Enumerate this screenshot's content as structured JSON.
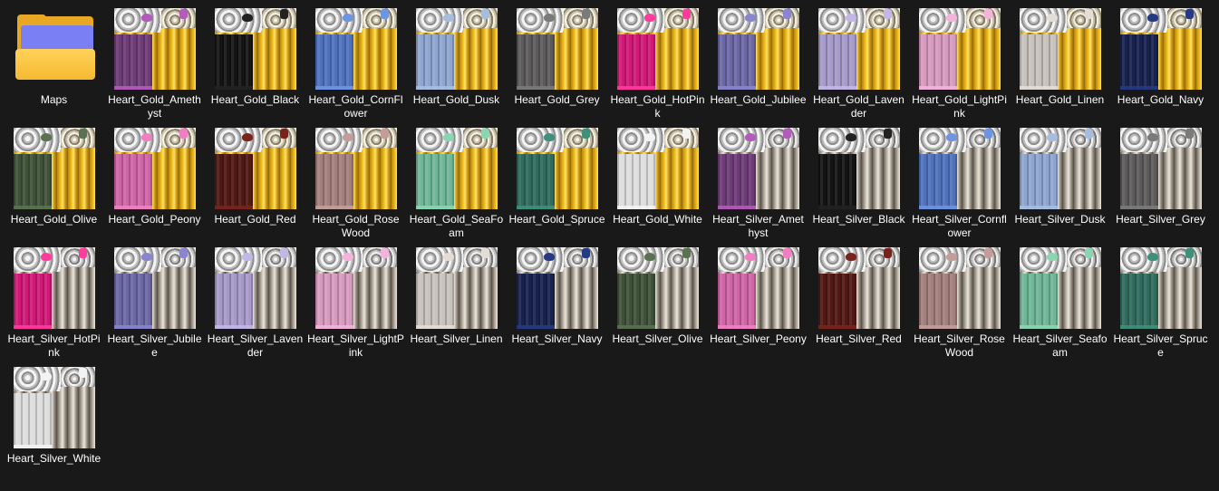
{
  "folder": {
    "label": "Maps",
    "icon": "folder-icon"
  },
  "files": [
    {
      "label": "Heart_Gold_Amethyst",
      "frame": "gold",
      "color": "#6f3a78",
      "bow": "#b25bb8"
    },
    {
      "label": "Heart_Gold_Black",
      "frame": "gold",
      "color": "#141414",
      "bow": "#222222"
    },
    {
      "label": "Heart_Gold_CornFlower",
      "frame": "gold",
      "color": "#4f72bf",
      "bow": "#6f95e0"
    },
    {
      "label": "Heart_Gold_Dusk",
      "frame": "gold",
      "color": "#8ea6cf",
      "bow": "#a7bde0"
    },
    {
      "label": "Heart_Gold_Grey",
      "frame": "gold",
      "color": "#5c5a5a",
      "bow": "#7a7a7a"
    },
    {
      "label": "Heart_Gold_HotPink",
      "frame": "gold",
      "color": "#d01876",
      "bow": "#ff3b9d"
    },
    {
      "label": "Heart_Gold_Jubilee",
      "frame": "gold",
      "color": "#6b67a6",
      "bow": "#8a85cc"
    },
    {
      "label": "Heart_Gold_Lavender",
      "frame": "gold",
      "color": "#a59ac9",
      "bow": "#c2b7e6"
    },
    {
      "label": "Heart_Gold_LightPink",
      "frame": "gold",
      "color": "#d99ac0",
      "bow": "#f2b4da"
    },
    {
      "label": "Heart_Gold_Linen",
      "frame": "gold",
      "color": "#c8c2bd",
      "bow": "#e2ddd7"
    },
    {
      "label": "Heart_Gold_Navy",
      "frame": "gold",
      "color": "#17224f",
      "bow": "#253a80"
    },
    {
      "label": "Heart_Gold_Olive",
      "frame": "gold",
      "color": "#3f5239",
      "bow": "#5a7250"
    },
    {
      "label": "Heart_Gold_Peony",
      "frame": "gold",
      "color": "#d064a6",
      "bow": "#ef7fc2"
    },
    {
      "label": "Heart_Gold_Red",
      "frame": "gold",
      "color": "#511814",
      "bow": "#7a221c"
    },
    {
      "label": "Heart_Gold_RoseWood",
      "frame": "gold",
      "color": "#a27f7c",
      "bow": "#c29d99"
    },
    {
      "label": "Heart_Gold_SeaFoam",
      "frame": "gold",
      "color": "#6fb697",
      "bow": "#8ad6b2"
    },
    {
      "label": "Heart_Gold_Spruce",
      "frame": "gold",
      "color": "#2f6c5d",
      "bow": "#3f8f7a"
    },
    {
      "label": "Heart_Gold_White",
      "frame": "gold",
      "color": "#dedede",
      "bow": "#f3f3f3"
    },
    {
      "label": "Heart_Silver_Amethyst",
      "frame": "silver",
      "color": "#6f3a78",
      "bow": "#b25bb8"
    },
    {
      "label": "Heart_Silver_Black",
      "frame": "silver",
      "color": "#141414",
      "bow": "#222222"
    },
    {
      "label": "Heart_Silver_Cornflower",
      "frame": "silver",
      "color": "#4f72bf",
      "bow": "#6f95e0"
    },
    {
      "label": "Heart_Silver_Dusk",
      "frame": "silver",
      "color": "#8ea6cf",
      "bow": "#a7bde0"
    },
    {
      "label": "Heart_Silver_Grey",
      "frame": "silver",
      "color": "#5c5a5a",
      "bow": "#7a7a7a"
    },
    {
      "label": "Heart_Silver_HotPink",
      "frame": "silver",
      "color": "#d01876",
      "bow": "#ff3b9d"
    },
    {
      "label": "Heart_Silver_Jubilee",
      "frame": "silver",
      "color": "#6b67a6",
      "bow": "#8a85cc"
    },
    {
      "label": "Heart_Silver_Lavender",
      "frame": "silver",
      "color": "#a59ac9",
      "bow": "#c2b7e6"
    },
    {
      "label": "Heart_Silver_LightPink",
      "frame": "silver",
      "color": "#d99ac0",
      "bow": "#f2b4da"
    },
    {
      "label": "Heart_Silver_Linen",
      "frame": "silver",
      "color": "#c8c2bd",
      "bow": "#e2ddd7"
    },
    {
      "label": "Heart_Silver_Navy",
      "frame": "silver",
      "color": "#17224f",
      "bow": "#253a80"
    },
    {
      "label": "Heart_Silver_Olive",
      "frame": "silver",
      "color": "#3f5239",
      "bow": "#5a7250"
    },
    {
      "label": "Heart_Silver_Peony",
      "frame": "silver",
      "color": "#d064a6",
      "bow": "#ef7fc2"
    },
    {
      "label": "Heart_Silver_Red",
      "frame": "silver",
      "color": "#511814",
      "bow": "#7a221c"
    },
    {
      "label": "Heart_Silver_RoseWood",
      "frame": "silver",
      "color": "#a27f7c",
      "bow": "#c29d99"
    },
    {
      "label": "Heart_Silver_Seafoam",
      "frame": "silver",
      "color": "#6fb697",
      "bow": "#8ad6b2"
    },
    {
      "label": "Heart_Silver_Spruce",
      "frame": "silver",
      "color": "#2f6c5d",
      "bow": "#3f8f7a"
    },
    {
      "label": "Heart_Silver_White",
      "frame": "silver",
      "color": "#dedede",
      "bow": "#f3f3f3"
    }
  ]
}
